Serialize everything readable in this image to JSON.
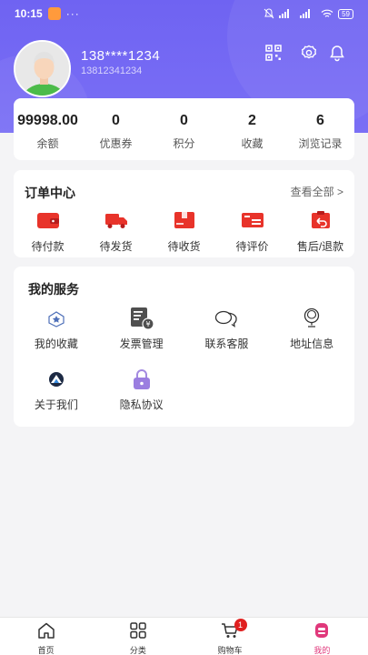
{
  "status_bar": {
    "time": "10:15",
    "dots": "···",
    "battery": "59"
  },
  "profile": {
    "phone_masked": "138****1234",
    "phone_full": "13812341234"
  },
  "header_icons": [
    "qr-code-icon",
    "gear-icon",
    "bell-icon"
  ],
  "stats": [
    {
      "value": "99998.00",
      "label": "余额"
    },
    {
      "value": "0",
      "label": "优惠券"
    },
    {
      "value": "0",
      "label": "积分"
    },
    {
      "value": "2",
      "label": "收藏"
    },
    {
      "value": "6",
      "label": "浏览记录"
    }
  ],
  "orders": {
    "title": "订单中心",
    "view_all": "查看全部 >",
    "items": [
      {
        "label": "待付款",
        "icon": "wallet-icon"
      },
      {
        "label": "待发货",
        "icon": "truck-icon"
      },
      {
        "label": "待收货",
        "icon": "package-icon"
      },
      {
        "label": "待评价",
        "icon": "review-icon"
      },
      {
        "label": "售后/退款",
        "icon": "refund-icon"
      }
    ]
  },
  "services": {
    "title": "我的服务",
    "items": [
      {
        "label": "我的收藏",
        "icon": "star-icon"
      },
      {
        "label": "发票管理",
        "icon": "invoice-icon"
      },
      {
        "label": "联系客服",
        "icon": "chat-icon"
      },
      {
        "label": "地址信息",
        "icon": "location-icon"
      },
      {
        "label": "关于我们",
        "icon": "about-icon"
      },
      {
        "label": "隐私协议",
        "icon": "lock-icon"
      }
    ]
  },
  "tabbar": {
    "items": [
      {
        "label": "首页",
        "icon": "home-icon"
      },
      {
        "label": "分类",
        "icon": "grid-icon"
      },
      {
        "label": "购物车",
        "icon": "cart-icon"
      },
      {
        "label": "我的",
        "icon": "user-icon"
      }
    ],
    "cart_count": "1"
  },
  "colors": {
    "primary": "#7066f3",
    "accent_red": "#e8332a",
    "active_tab": "#e0387b"
  }
}
